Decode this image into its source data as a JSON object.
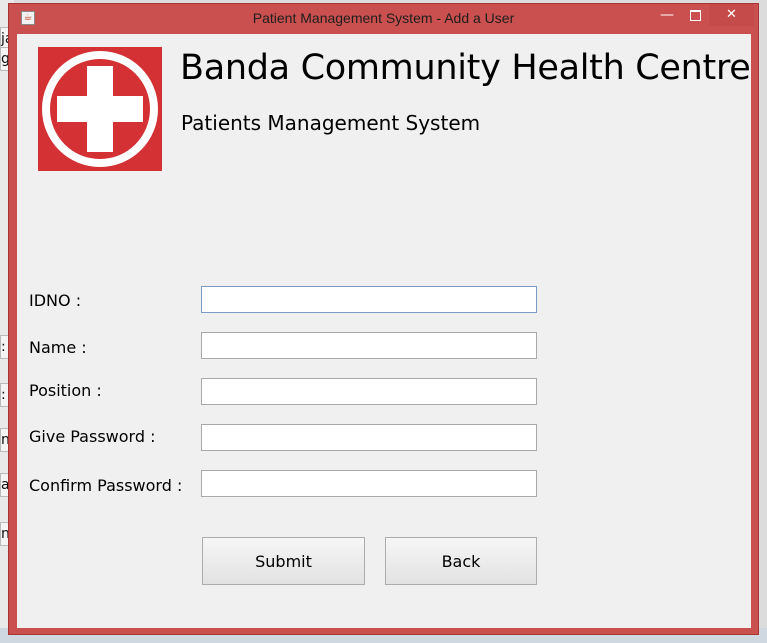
{
  "window": {
    "title": "Patient Management System - Add a User",
    "minimize_label": "—",
    "close_label": "✕"
  },
  "background_fragments": [
    "ja",
    "gr",
    ":",
    ":",
    "n",
    "as",
    "n"
  ],
  "header": {
    "organization": "Banda Community Health Centre",
    "system": "Patients Management System",
    "logo_icon": "red-cross-icon"
  },
  "form": {
    "fields": [
      {
        "label": "IDNO :",
        "value": ""
      },
      {
        "label": "Name :",
        "value": ""
      },
      {
        "label": "Position :",
        "value": ""
      },
      {
        "label": "Give Password :",
        "value": ""
      },
      {
        "label": "Confirm Password :",
        "value": ""
      }
    ]
  },
  "buttons": {
    "submit": "Submit",
    "back": "Back"
  },
  "colors": {
    "window_frame": "#c9504e",
    "logo_red": "#d43134"
  }
}
